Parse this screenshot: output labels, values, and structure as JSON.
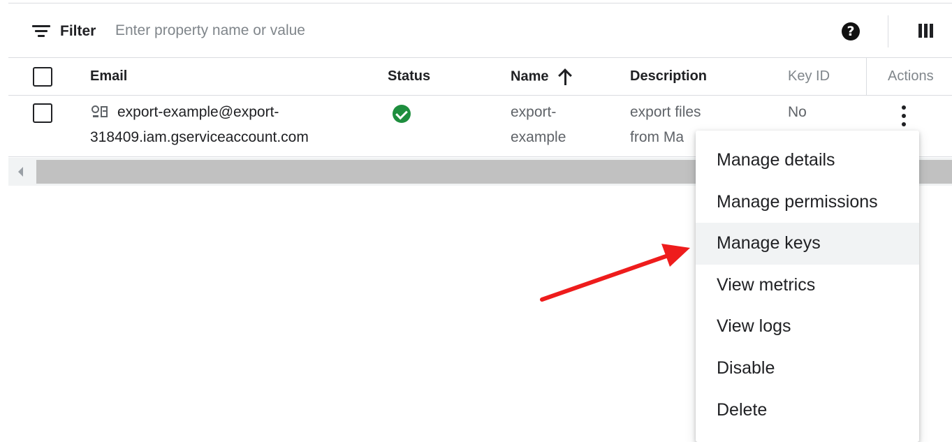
{
  "filter": {
    "label": "Filter",
    "placeholder": "Enter property name or value",
    "value": ""
  },
  "toolbar": {
    "help_icon": "help-circle-icon",
    "help_glyph": "?",
    "columns_icon": "column-display-icon"
  },
  "table": {
    "headers": {
      "email": "Email",
      "status": "Status",
      "name": "Name",
      "description": "Description",
      "key_id": "Key ID",
      "actions": "Actions"
    },
    "sort": {
      "column": "name",
      "direction": "ascending",
      "icon": "arrow-up-icon"
    },
    "rows": [
      {
        "checked": false,
        "email_icon": "service-account-icon",
        "email_line1": "export-example@export-",
        "email_line2": "318409.iam.gserviceaccount.com",
        "status_icon": "check-circle-icon",
        "status_color": "#1e8e3e",
        "name_line1": "export-",
        "name_line2": "example",
        "description_line1": "export files",
        "description_line2": "from Ma",
        "key_id": "No",
        "actions_icon": "more-vert-icon"
      }
    ]
  },
  "menu": {
    "items": [
      "Manage details",
      "Manage permissions",
      "Manage keys",
      "View metrics",
      "View logs",
      "Disable",
      "Delete"
    ],
    "highlighted": "Manage keys"
  },
  "annotation": {
    "type": "arrow",
    "color": "#ee1c1c",
    "points_to": "Manage keys"
  },
  "colors": {
    "text_primary": "#202124",
    "text_muted": "#80868b",
    "border": "#dadce0",
    "menu_hover": "#f1f3f4"
  }
}
